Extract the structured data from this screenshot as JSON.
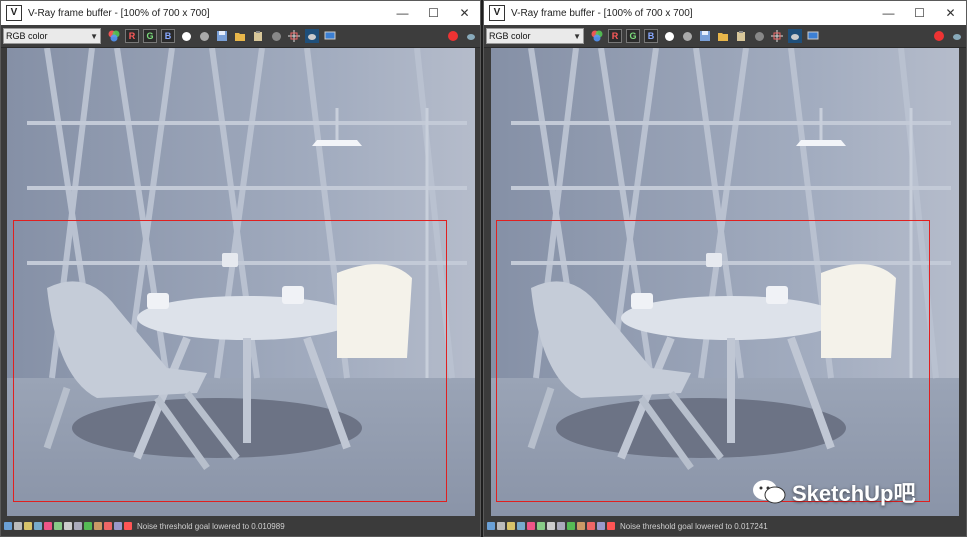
{
  "windows": [
    {
      "title": "V-Ray frame buffer - [100% of 700 x 700]",
      "channel_select": "RGB color",
      "channels": [
        "R",
        "G",
        "B"
      ],
      "status": "Noise threshold goal lowered to 0.010989"
    },
    {
      "title": "V-Ray frame buffer - [100% of 700 x 700]",
      "channel_select": "RGB color",
      "channels": [
        "R",
        "G",
        "B"
      ],
      "status": "Noise threshold goal lowered to 0.017241"
    }
  ],
  "window_controls": {
    "minimize": "—",
    "maximize": "☐",
    "close": "✕"
  },
  "icons": [
    "vray-logo-icon",
    "color-wheel-icon",
    "white-dot-icon",
    "grey-dot-icon",
    "save-icon",
    "open-folder-icon",
    "clipboard-icon",
    "sphere-icon",
    "region-render-icon",
    "teapot-render-icon",
    "display-icon",
    "stop-icon"
  ],
  "colors": {
    "region_border": "#e02020",
    "window_bg": "#3b3b3b",
    "titlebar": "#ffffff"
  },
  "watermark": "SketchUp吧"
}
